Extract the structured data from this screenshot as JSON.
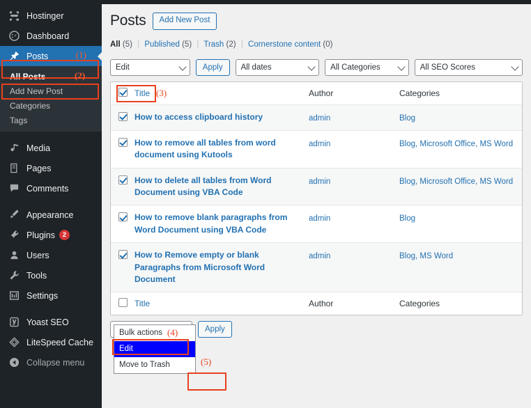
{
  "sidebar": {
    "items": [
      {
        "label": "Hostinger",
        "icon": "hostinger-icon",
        "state": "normal"
      },
      {
        "label": "Dashboard",
        "icon": "dashboard-icon",
        "state": "normal"
      },
      {
        "label": "Posts",
        "icon": "pin-icon",
        "state": "current",
        "annotation": "(1)"
      },
      {
        "label": "Media",
        "icon": "media-icon",
        "state": "normal"
      },
      {
        "label": "Pages",
        "icon": "pages-icon",
        "state": "normal"
      },
      {
        "label": "Comments",
        "icon": "comments-icon",
        "state": "normal"
      },
      {
        "label": "Appearance",
        "icon": "appearance-icon",
        "state": "normal"
      },
      {
        "label": "Plugins",
        "icon": "plugins-icon",
        "state": "normal",
        "badge": "2"
      },
      {
        "label": "Users",
        "icon": "users-icon",
        "state": "normal"
      },
      {
        "label": "Tools",
        "icon": "tools-icon",
        "state": "normal"
      },
      {
        "label": "Settings",
        "icon": "settings-icon",
        "state": "normal"
      },
      {
        "label": "Yoast SEO",
        "icon": "yoast-icon",
        "state": "normal"
      },
      {
        "label": "LiteSpeed Cache",
        "icon": "litespeed-icon",
        "state": "normal"
      },
      {
        "label": "Collapse menu",
        "icon": "collapse-icon",
        "state": "normal"
      }
    ],
    "submenu": [
      {
        "label": "All Posts",
        "state": "current",
        "annotation": "(2)"
      },
      {
        "label": "Add New Post",
        "state": "normal"
      },
      {
        "label": "Categories",
        "state": "normal"
      },
      {
        "label": "Tags",
        "state": "normal"
      }
    ]
  },
  "header": {
    "title": "Posts",
    "add_new_label": "Add New Post"
  },
  "status_filters": [
    {
      "label": "All",
      "count": "(5)",
      "current": true
    },
    {
      "label": "Published",
      "count": "(5)",
      "current": false
    },
    {
      "label": "Trash",
      "count": "(2)",
      "current": false
    },
    {
      "label": "Cornerstone content",
      "count": "(0)",
      "current": false
    }
  ],
  "toolbar_top": {
    "bulk_action_value": "Edit",
    "apply_label": "Apply",
    "dates_value": "All dates",
    "categories_value": "All Categories",
    "seo_value": "All SEO Scores"
  },
  "toolbar_bottom": {
    "bulk_action_value": "Edit",
    "apply_label": "Apply",
    "annotation_apply": "(5)"
  },
  "bulk_dropdown": {
    "annotation": "(4)",
    "options": [
      {
        "label": "Bulk actions",
        "highlight": false
      },
      {
        "label": "Edit",
        "highlight": true
      },
      {
        "label": "Move to Trash",
        "highlight": false
      }
    ]
  },
  "table": {
    "columns": {
      "title": "Title",
      "author": "Author",
      "categories": "Categories"
    },
    "title_annotation": "(3)",
    "header_checkbox_checked": true,
    "rows": [
      {
        "checked": true,
        "title": "How to access clipboard history",
        "author": "admin",
        "categories": "Blog"
      },
      {
        "checked": true,
        "title": "How to remove all tables from word document using Kutools",
        "author": "admin",
        "categories": "Blog, Microsoft Office, MS Word"
      },
      {
        "checked": true,
        "title": "How to delete all tables from Word Document using VBA Code",
        "author": "admin",
        "categories": "Blog, Microsoft Office, MS Word"
      },
      {
        "checked": true,
        "title": "How to remove blank paragraphs from Word Document using VBA Code",
        "author": "admin",
        "categories": "Blog"
      },
      {
        "checked": true,
        "title": "How to Remove empty or blank Paragraphs from Microsoft Word Document",
        "author": "admin",
        "categories": "Blog, MS Word"
      }
    ]
  },
  "colors": {
    "accent": "#2271b1",
    "sidebar_bg": "#1d2327",
    "submenu_bg": "#2c3338",
    "annotation": "#e8401c",
    "badge": "#d63638",
    "highlight": "#0000ff"
  }
}
